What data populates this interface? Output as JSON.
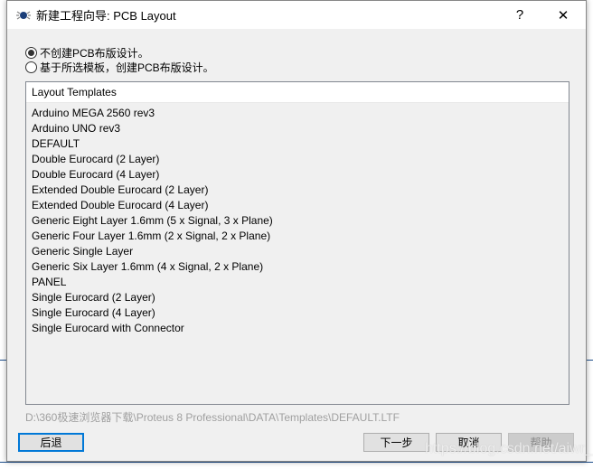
{
  "window": {
    "title": "新建工程向导: PCB Layout",
    "help_label": "?",
    "close_label": "✕"
  },
  "options": [
    {
      "label": "不创建PCB布版设计。",
      "selected": true
    },
    {
      "label": "基于所选模板，创建PCB布版设计。",
      "selected": false
    }
  ],
  "list": {
    "header": "Layout Templates",
    "items": [
      "Arduino MEGA 2560 rev3",
      "Arduino UNO rev3",
      "DEFAULT",
      "Double Eurocard (2 Layer)",
      "Double Eurocard (4 Layer)",
      "Extended Double Eurocard (2 Layer)",
      "Extended Double Eurocard (4 Layer)",
      "Generic Eight Layer 1.6mm (5 x Signal, 3 x Plane)",
      "Generic Four Layer 1.6mm (2 x Signal, 2 x Plane)",
      "Generic Single Layer",
      "Generic Six Layer 1.6mm (4 x Signal, 2 x Plane)",
      "PANEL",
      "Single Eurocard (2 Layer)",
      "Single Eurocard (4 Layer)",
      "Single Eurocard with Connector"
    ]
  },
  "path": "D:\\360极速浏览器下载\\Proteus 8 Professional\\DATA\\Templates\\DEFAULT.LTF",
  "buttons": {
    "back": "后退",
    "next": "下一步",
    "cancel": "取消",
    "help": "帮助"
  },
  "watermark": "https://blog.csdn.net/aiwr_",
  "colors": {
    "accent": "#0078d7"
  }
}
